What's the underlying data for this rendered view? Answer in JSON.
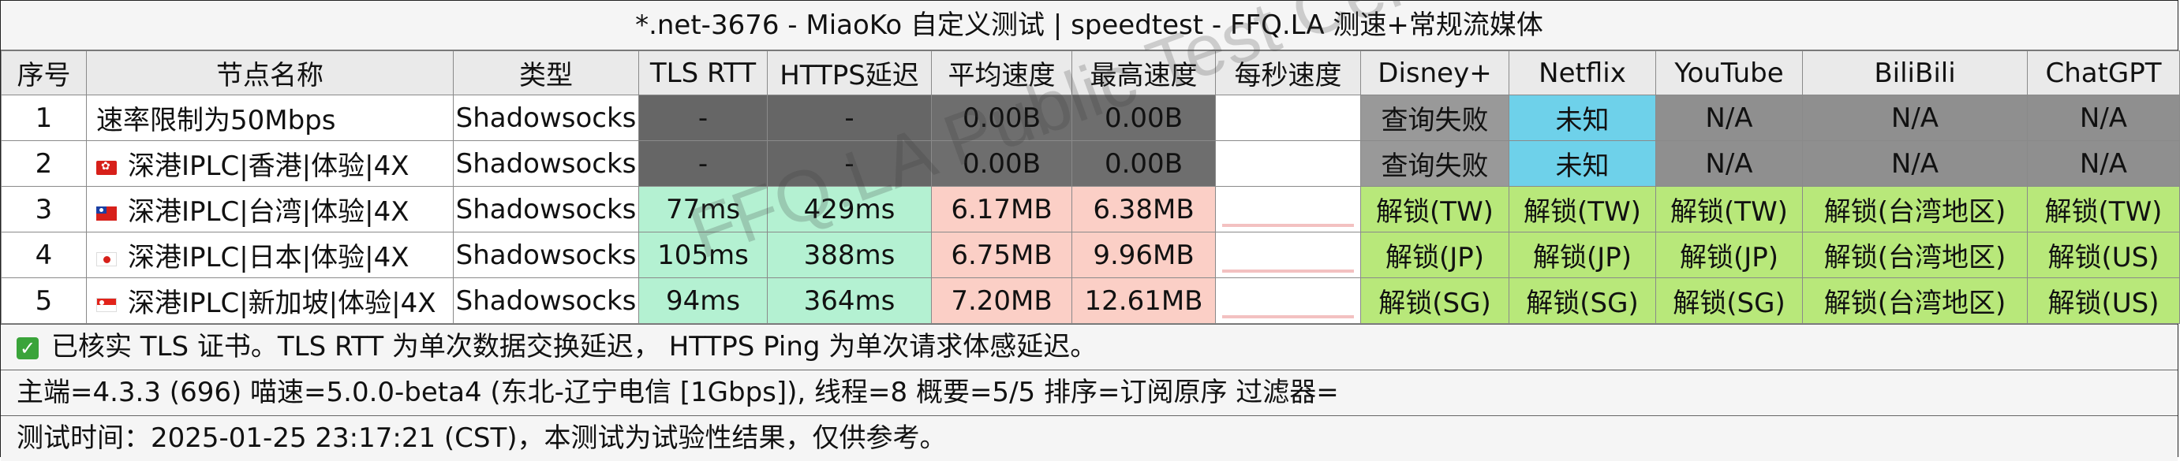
{
  "title": "*.net-3676 - MiaoKo 自定义测试 | speedtest - FFQ.LA 测速+常规流媒体",
  "headers": [
    "序号",
    "节点名称",
    "类型",
    "TLS RTT",
    "HTTPS延迟",
    "平均速度",
    "最高速度",
    "每秒速度",
    "Disney+",
    "Netflix",
    "YouTube",
    "BiliBili",
    "ChatGPT"
  ],
  "rows": [
    {
      "idx": "1",
      "flag": "",
      "name": "速率限制为50Mbps",
      "type": "Shadowsocks",
      "tls": "-",
      "https": "-",
      "avg": "0.00B",
      "max": "0.00B",
      "disney": "查询失败",
      "netflix": "未知",
      "youtube": "N/A",
      "bili": "N/A",
      "chatgpt": "N/A"
    },
    {
      "idx": "2",
      "flag": "hk",
      "name": "深港IPLC|香港|体验|4X",
      "type": "Shadowsocks",
      "tls": "-",
      "https": "-",
      "avg": "0.00B",
      "max": "0.00B",
      "disney": "查询失败",
      "netflix": "未知",
      "youtube": "N/A",
      "bili": "N/A",
      "chatgpt": "N/A"
    },
    {
      "idx": "3",
      "flag": "tw",
      "name": "深港IPLC|台湾|体验|4X",
      "type": "Shadowsocks",
      "tls": "77ms",
      "https": "429ms",
      "avg": "6.17MB",
      "max": "6.38MB",
      "disney": "解锁(TW)",
      "netflix": "解锁(TW)",
      "youtube": "解锁(TW)",
      "bili": "解锁(台湾地区)",
      "chatgpt": "解锁(TW)"
    },
    {
      "idx": "4",
      "flag": "jp",
      "name": "深港IPLC|日本|体验|4X",
      "type": "Shadowsocks",
      "tls": "105ms",
      "https": "388ms",
      "avg": "6.75MB",
      "max": "9.96MB",
      "disney": "解锁(JP)",
      "netflix": "解锁(JP)",
      "youtube": "解锁(JP)",
      "bili": "解锁(台湾地区)",
      "chatgpt": "解锁(US)"
    },
    {
      "idx": "5",
      "flag": "sg",
      "name": "深港IPLC|新加坡|体验|4X",
      "type": "Shadowsocks",
      "tls": "94ms",
      "https": "364ms",
      "avg": "7.20MB",
      "max": "12.61MB",
      "disney": "解锁(SG)",
      "netflix": "解锁(SG)",
      "youtube": "解锁(SG)",
      "bili": "解锁(台湾地区)",
      "chatgpt": "解锁(US)"
    }
  ],
  "footer": {
    "tls_note": "已核实 TLS 证书。TLS RTT 为单次数据交换延迟， HTTPS Ping 为单次请求体感延迟。",
    "info": "主端=4.3.3 (696) 喵速=5.0.0-beta4 (东北-辽宁电信 [1Gbps]), 线程=8 概要=5/5 排序=订阅原序 过滤器=",
    "time": "测试时间：2025-01-25 23:17:21 (CST)，本测试为试验性结果，仅供参考。"
  },
  "watermark": "FFQ.LA Public Test Center",
  "colors": {
    "gray_cell": "#666666",
    "green_cell": "#b4f1d2",
    "pink_cell": "#fbcfc6",
    "unlock": "#b8e87a",
    "unknown": "#6ed1ea",
    "fail": "#999999"
  }
}
